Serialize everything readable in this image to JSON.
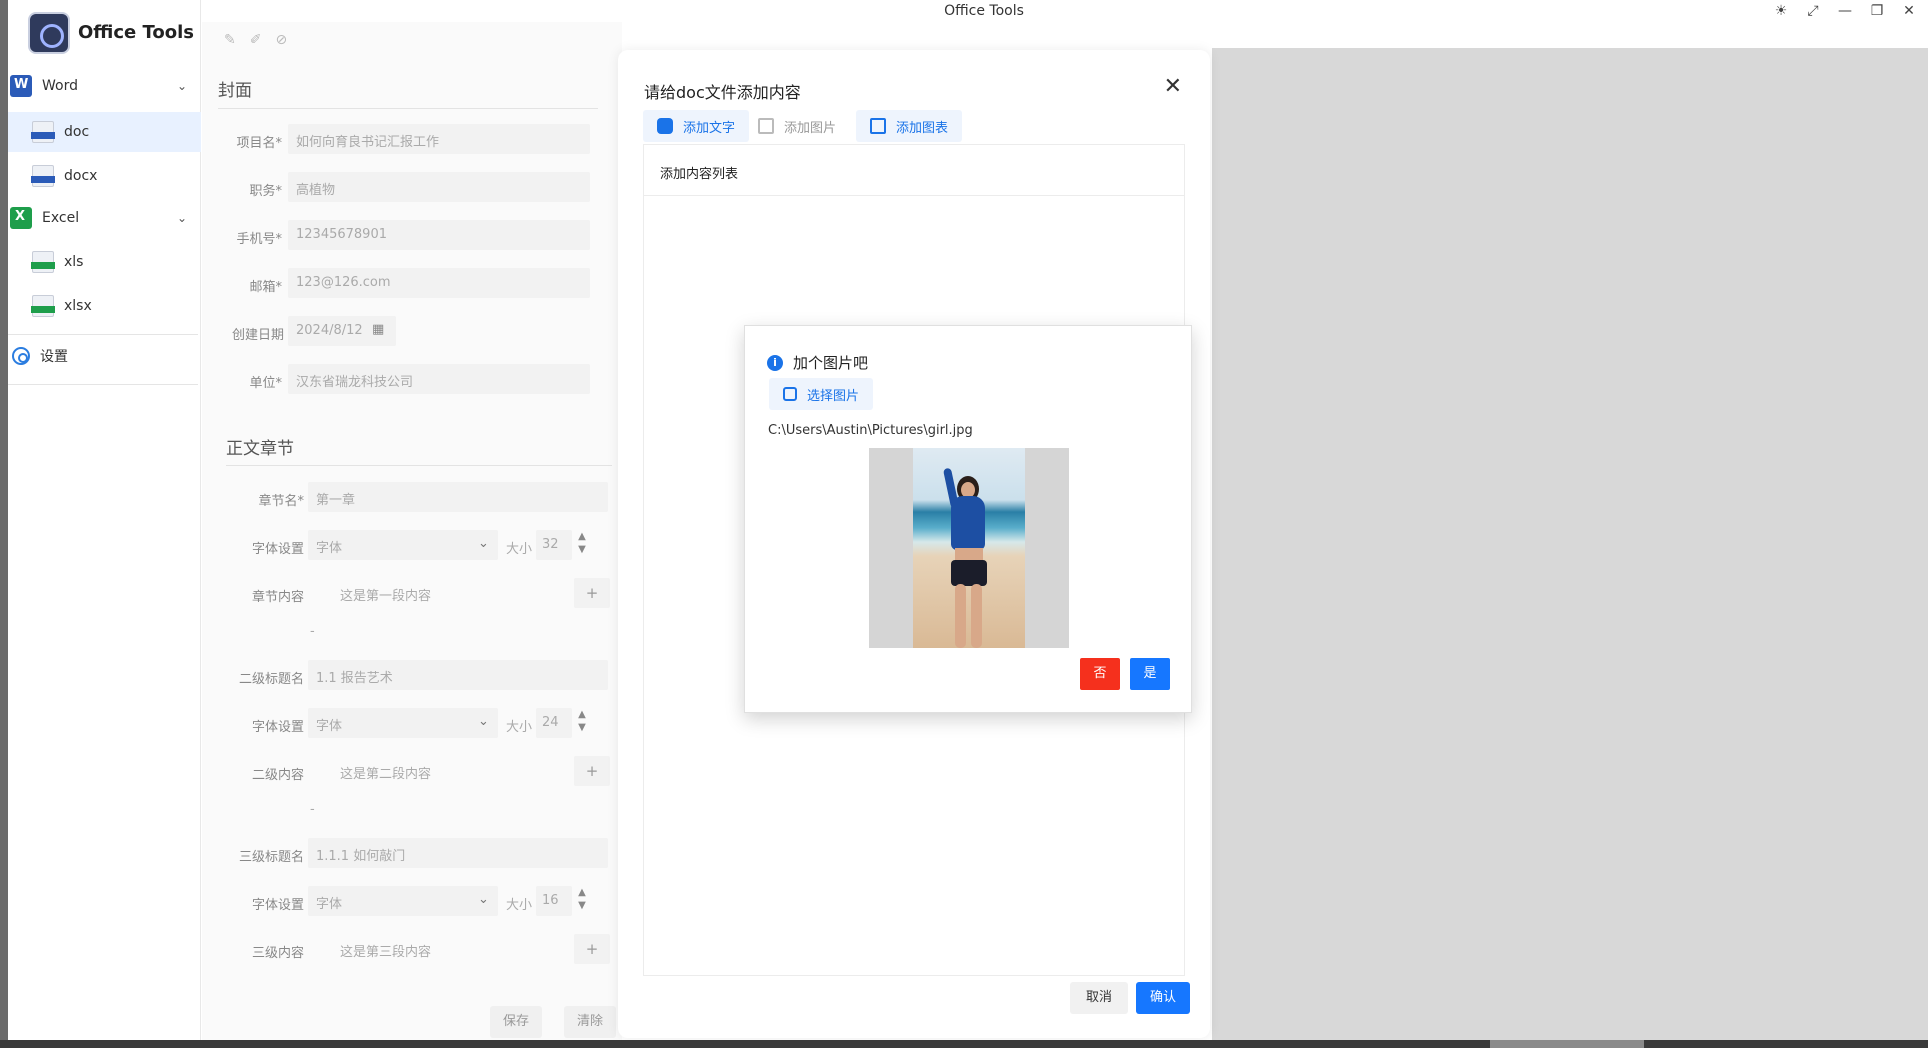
{
  "window": {
    "title": "Office Tools",
    "controls": [
      "☀",
      "⤢",
      "—",
      "❐",
      "✕"
    ]
  },
  "sidebar": {
    "app_name": "Office Tools",
    "groups": [
      {
        "label": "Word",
        "items": [
          "doc",
          "docx"
        ]
      },
      {
        "label": "Excel",
        "items": [
          "xls",
          "xlsx"
        ]
      }
    ],
    "settings_label": "设置",
    "active_item": "doc"
  },
  "form": {
    "cover_title": "封面",
    "fields": [
      {
        "label": "项目名*",
        "value": "如何向育良书记汇报工作"
      },
      {
        "label": "职务*",
        "value": "高植物"
      },
      {
        "label": "手机号*",
        "value": "12345678901"
      },
      {
        "label": "邮箱*",
        "value": "123@126.com"
      },
      {
        "label": "创建日期",
        "value": "2024/8/12"
      },
      {
        "label": "单位*",
        "value": "汉东省瑞龙科技公司"
      }
    ],
    "body_title": "正文章节",
    "chapter_label": "章节名*",
    "chapter_value": "第一章",
    "font_label": "字体设置",
    "font_placeholder": "字体",
    "size_label": "大小",
    "sizes": [
      "32",
      "24",
      "16"
    ],
    "content_labels": [
      "章节内容",
      "二级内容",
      "三级内容"
    ],
    "content_values": [
      "这是第一段内容",
      "这是第二段内容",
      "这是第三段内容"
    ],
    "h2_label": "二级标题名",
    "h2_value": "1.1 报告艺术",
    "h3_label": "三级标题名",
    "h3_value": "1.1.1 如何敲门",
    "plus": "+",
    "dash": "-",
    "save": "保存",
    "clear": "清除"
  },
  "dialog": {
    "title": "请给doc文件添加内容",
    "close": "✕",
    "tabs": [
      "添加文字",
      "添加图片",
      "添加图表"
    ],
    "list_header": "添加内容列表",
    "cancel": "取消",
    "confirm": "确认"
  },
  "popup": {
    "title": "加个图片吧",
    "info": "i",
    "choose": "选择图片",
    "path": "C:\\Users\\Austin\\Pictures\\girl.jpg",
    "no": "否",
    "yes": "是"
  }
}
